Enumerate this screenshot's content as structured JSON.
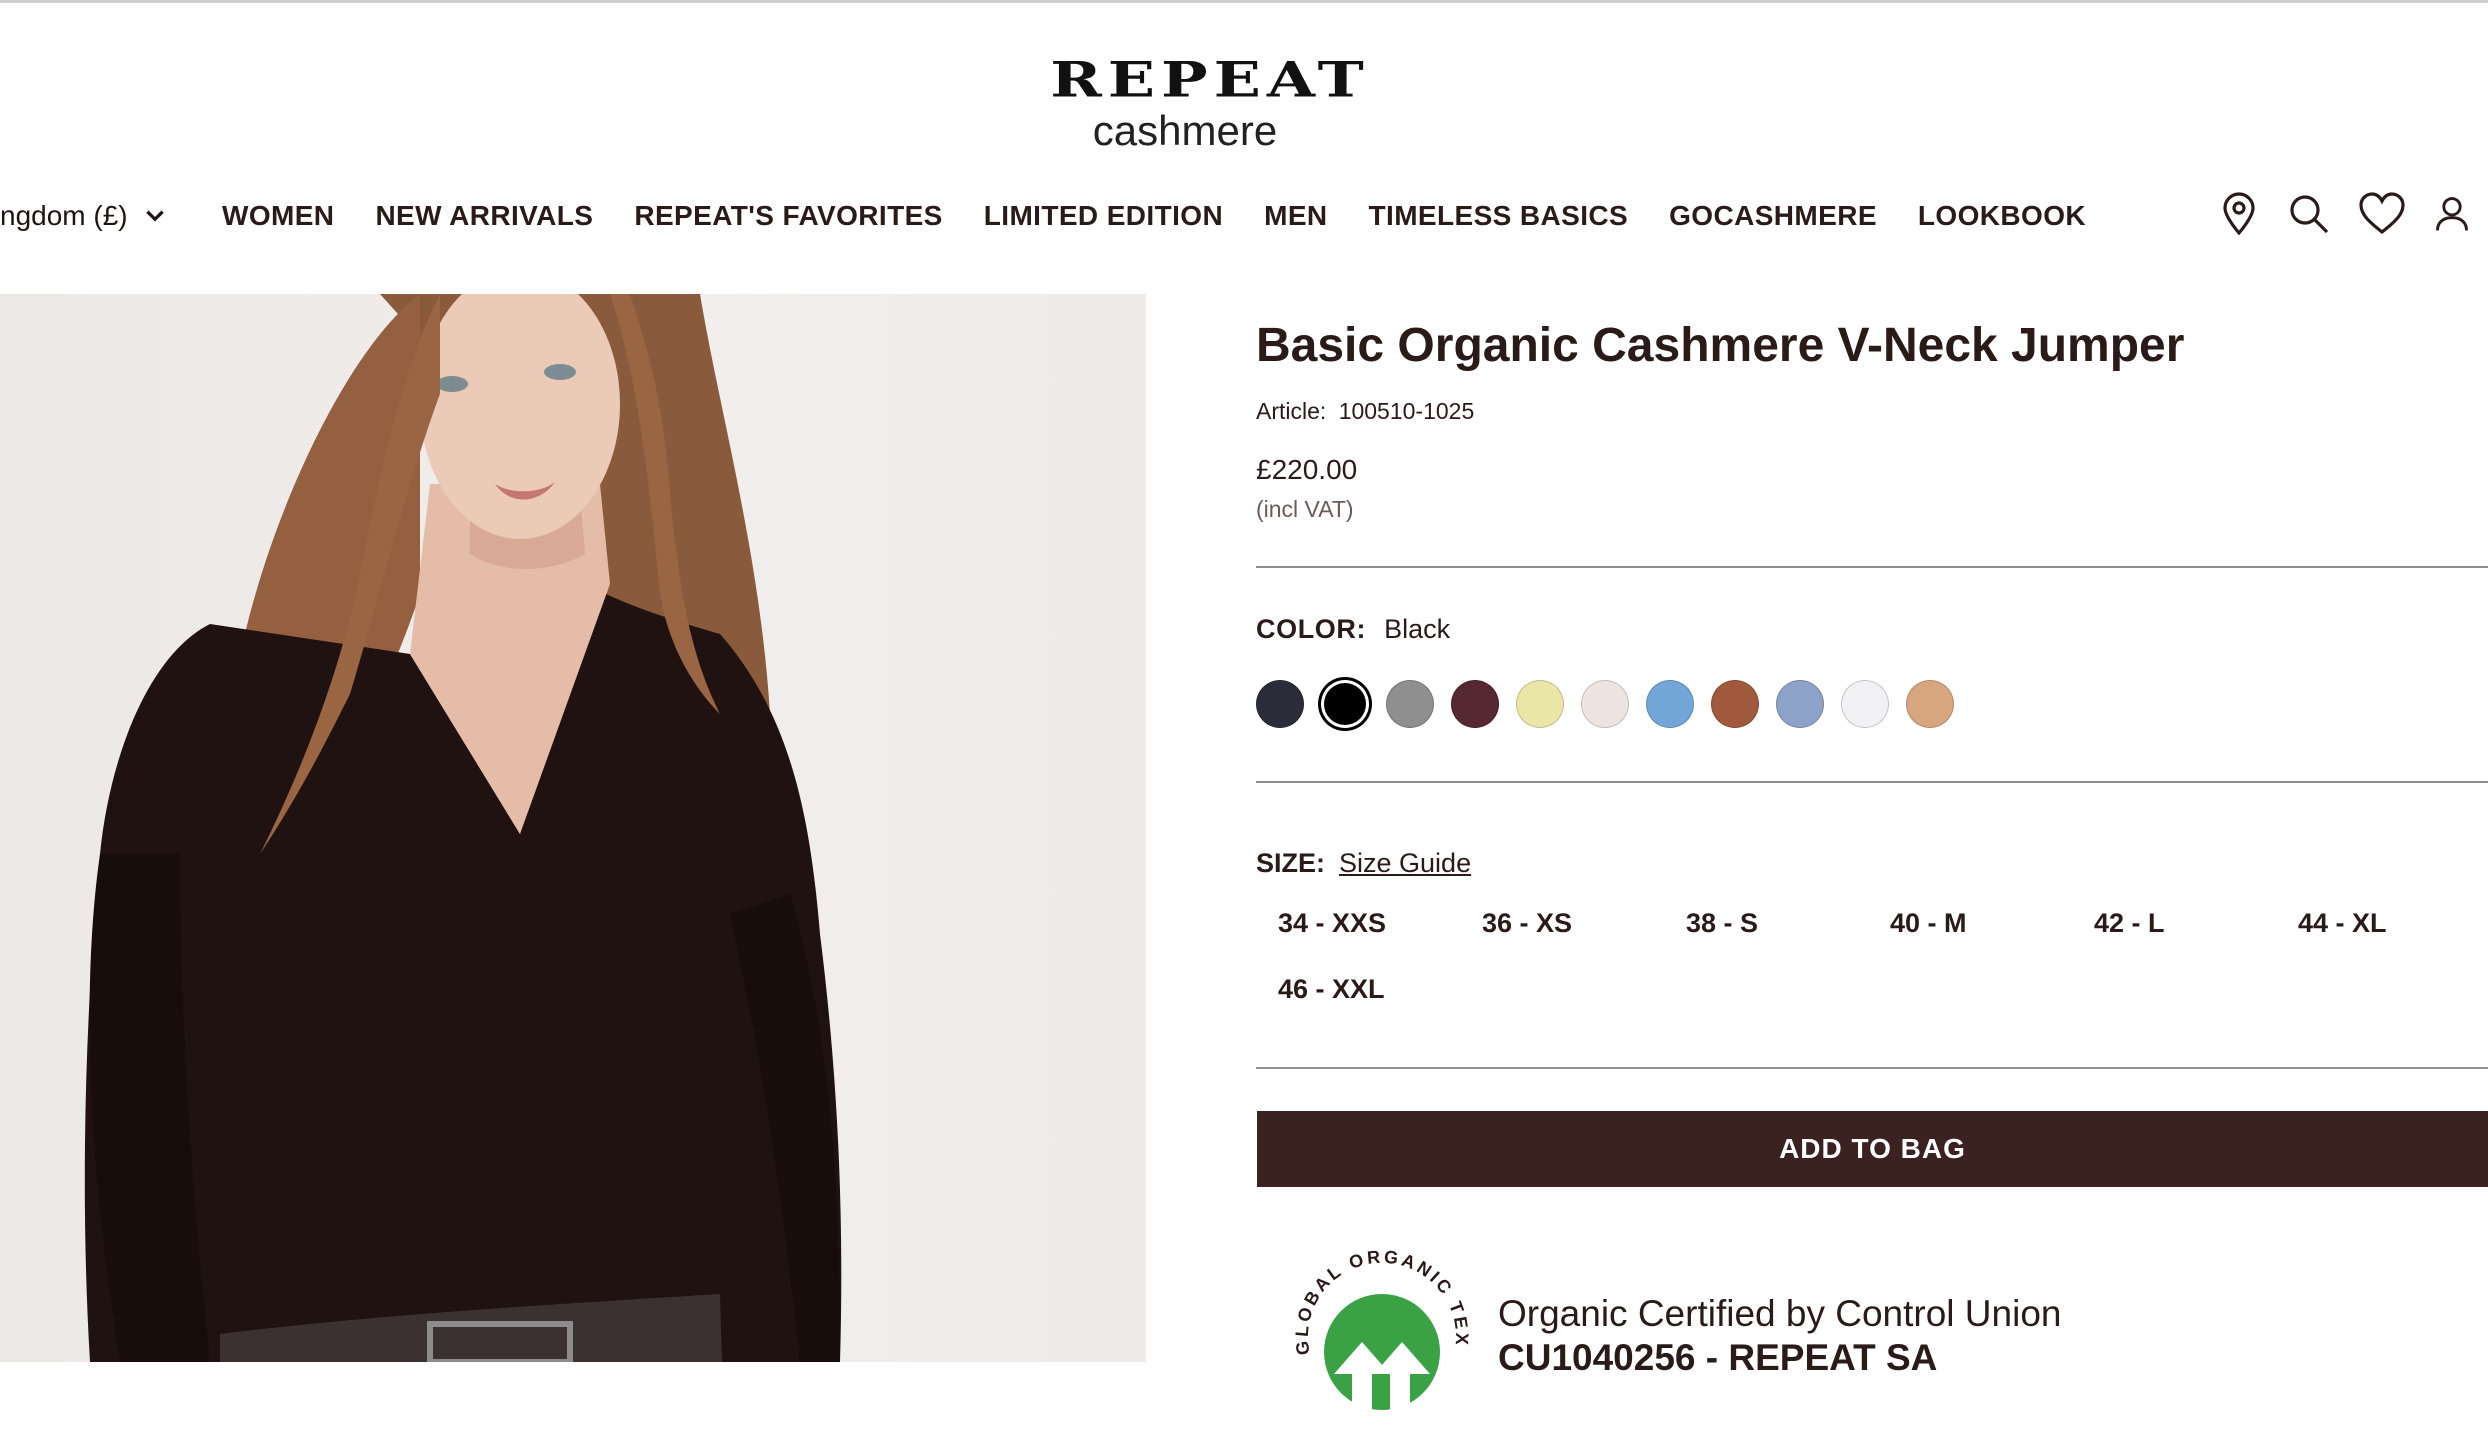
{
  "header": {
    "logo_main": "REPEAT",
    "logo_sub": "cashmere",
    "region_label": "ngdom (£)",
    "nav": [
      "WOMEN",
      "NEW ARRIVALS",
      "REPEAT'S FAVORITES",
      "LIMITED EDITION",
      "MEN",
      "TIMELESS BASICS",
      "GOCASHMERE",
      "LOOKBOOK"
    ],
    "icons": [
      "location-pin-icon",
      "search-icon",
      "heart-icon",
      "account-icon"
    ]
  },
  "product": {
    "title": "Basic Organic Cashmere V-Neck Jumper",
    "article_label": "Article:",
    "article_number": "100510-1025",
    "price": "£220.00",
    "vat_note": "(incl VAT)",
    "color_label": "COLOR:",
    "color_value": "Black",
    "colors": [
      "#2a2c3a",
      "#000000",
      "#8f8f8f",
      "#552832",
      "#e9e6a6",
      "#eee5e2",
      "#72a6d8",
      "#a1593e",
      "#8ca2c8",
      "#f1f1f3",
      "#d8a67e"
    ],
    "selected_color_index": 1,
    "size_label": "SIZE:",
    "size_guide": "Size Guide",
    "sizes": [
      "34 - XXS",
      "36 - XS",
      "38 - S",
      "40 - M",
      "42 - L",
      "44 - XL",
      "46 - XXL"
    ],
    "add_to_bag": "ADD TO BAG",
    "cert_line1": "Organic Certified by Control Union",
    "cert_line2": "CU1040256 - REPEAT SA",
    "cert_badge_text": "GLOBAL ORGANIC TEXTILE STANDARD"
  }
}
